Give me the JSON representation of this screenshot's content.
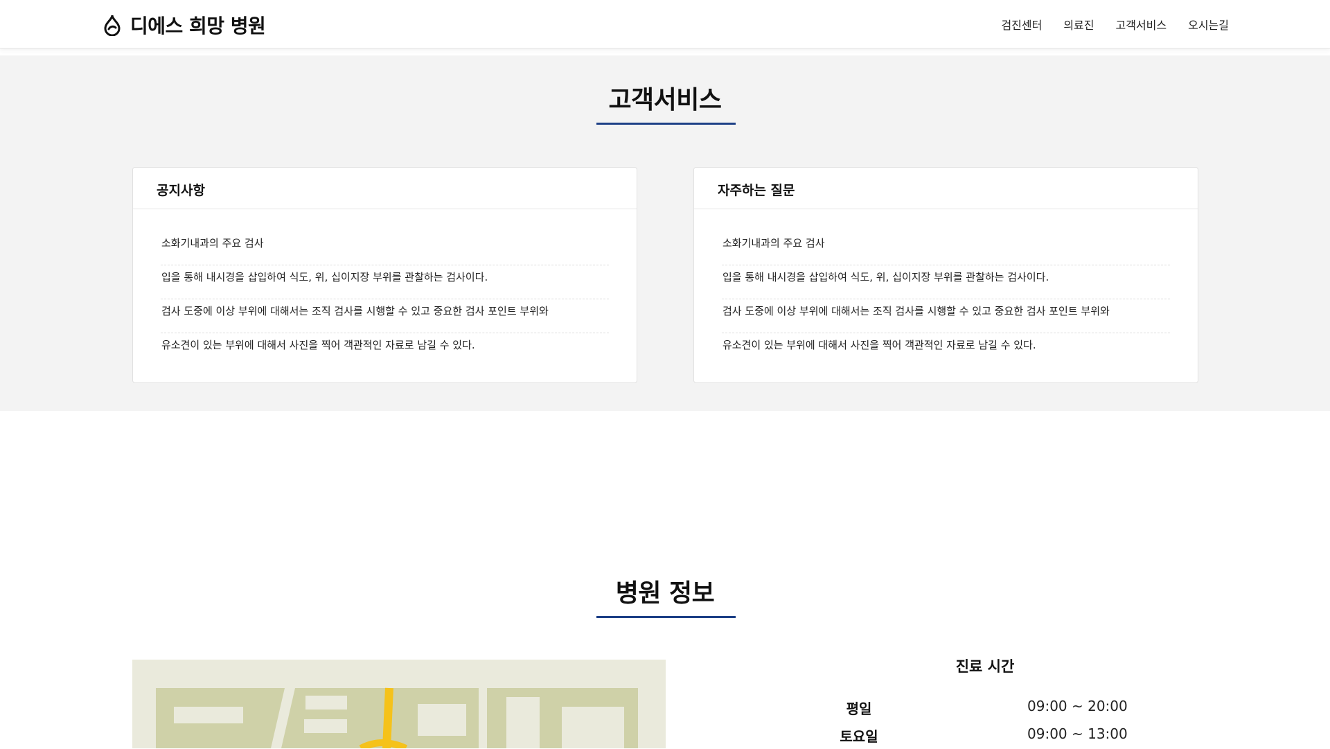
{
  "header": {
    "logo_title": "디에스 희망 병원",
    "logo_icon": "drop-icon",
    "nav": [
      "검진센터",
      "의료진",
      "고객서비스",
      "오시는길"
    ]
  },
  "service": {
    "title": "고객서비스",
    "notice": {
      "title": "공지사항",
      "items": [
        "소화기내과의 주요 검사",
        "입을 통해 내시경을 삽입하여 식도, 위, 십이지장 부위를 관찰하는 검사이다.",
        "검사 도중에 이상 부위에 대해서는 조직 검사를 시행할 수 있고 중요한 검사 포인트 부위와",
        "유소견이 있는 부위에 대해서 사진을 찍어 객관적인 자료로 남길 수 있다."
      ]
    },
    "faq": {
      "title": "자주하는 질문",
      "items": [
        "소화기내과의 주요 검사",
        "입을 통해 내시경을 삽입하여 식도, 위, 십이지장 부위를 관찰하는 검사이다.",
        "검사 도중에 이상 부위에 대해서는 조직 검사를 시행할 수 있고 중요한 검사 포인트 부위와",
        "유소견이 있는 부위에 대해서 사진을 찍어 객관적인 자료로 남길 수 있다."
      ]
    }
  },
  "hospital_info": {
    "title": "병원 정보",
    "hours": {
      "title": "진료 시간",
      "rows": [
        {
          "day": "평일",
          "time": "09:00 ~ 20:00"
        },
        {
          "day": "토요일",
          "time": "09:00 ~ 13:00"
        }
      ]
    }
  },
  "colors": {
    "accent": "#1c3f86",
    "section_bg": "#f3f3f3",
    "map_bg": "#eaeadc",
    "map_block": "#cfd1a8",
    "map_road": "#f5c21a"
  }
}
